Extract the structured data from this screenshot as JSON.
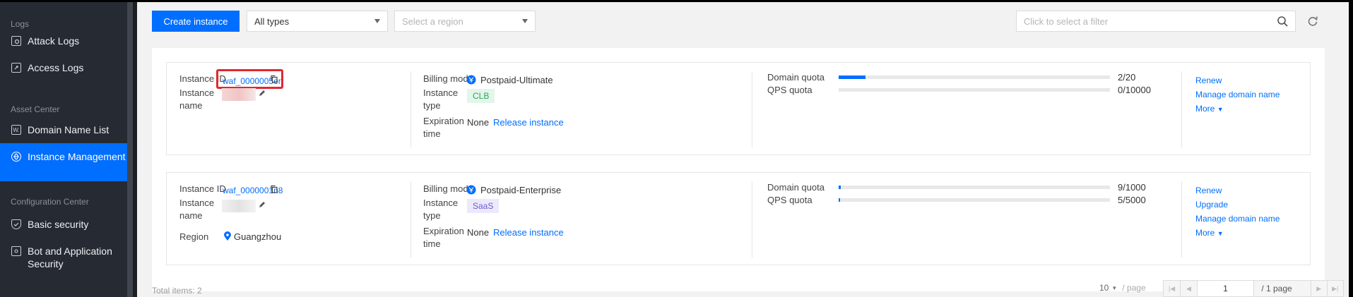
{
  "sidebar": {
    "sections": {
      "logs": "Logs",
      "asset_center": "Asset Center",
      "configuration_center": "Configuration Center"
    },
    "items": [
      {
        "label": "Attack Logs",
        "icon": "attack-log-icon"
      },
      {
        "label": "Access Logs",
        "icon": "access-log-icon"
      },
      {
        "label": "Domain Name List",
        "icon": "domain-list-icon"
      },
      {
        "label": "Instance Management",
        "icon": "instance-icon",
        "active": true
      },
      {
        "label": "Basic security",
        "icon": "shield-icon"
      },
      {
        "label": "Bot and Application Security",
        "icon": "bot-icon"
      }
    ]
  },
  "toolbar": {
    "create_label": "Create instance",
    "type_select": "All types",
    "region_placeholder": "Select a region",
    "filter_placeholder": "Click to select a filter"
  },
  "instances": [
    {
      "id_label": "Instance ID",
      "id": "waf_0000005er",
      "name_label": "Instance name",
      "billing_label": "Billing mode",
      "billing": "Postpaid-Ultimate",
      "type_label": "Instance type",
      "type": "CLB",
      "expiration_label": "Expiration time",
      "expiration": "None",
      "release": "Release instance",
      "domain_quota_label": "Domain quota",
      "domain_quota": "2/20",
      "domain_ratio": 0.1,
      "qps_quota_label": "QPS quota",
      "qps_quota": "0/10000",
      "qps_ratio": 0.0,
      "actions": [
        "Renew",
        "Manage domain name",
        "More"
      ]
    },
    {
      "id_label": "Instance ID",
      "id": "waf_0000001n8",
      "name_label": "Instance name",
      "region_label": "Region",
      "region": "Guangzhou",
      "billing_label": "Billing mode",
      "billing": "Postpaid-Enterprise",
      "type_label": "Instance type",
      "type": "SaaS",
      "expiration_label": "Expiration time",
      "expiration": "None",
      "release": "Release instance",
      "domain_quota_label": "Domain quota",
      "domain_quota": "9/1000",
      "domain_ratio": 0.009,
      "qps_quota_label": "QPS quota",
      "qps_quota": "5/5000",
      "qps_ratio": 0.001,
      "actions": [
        "Renew",
        "Upgrade",
        "Manage domain name",
        "More"
      ]
    }
  ],
  "footer": {
    "total": "Total items: 2",
    "page_size": "10",
    "per_page": "/ page",
    "page": "1",
    "page_total": "/ 1 page"
  },
  "colors": {
    "accent": "#006eff",
    "sidebar_bg": "#262a33",
    "highlight": "#e0282e"
  }
}
